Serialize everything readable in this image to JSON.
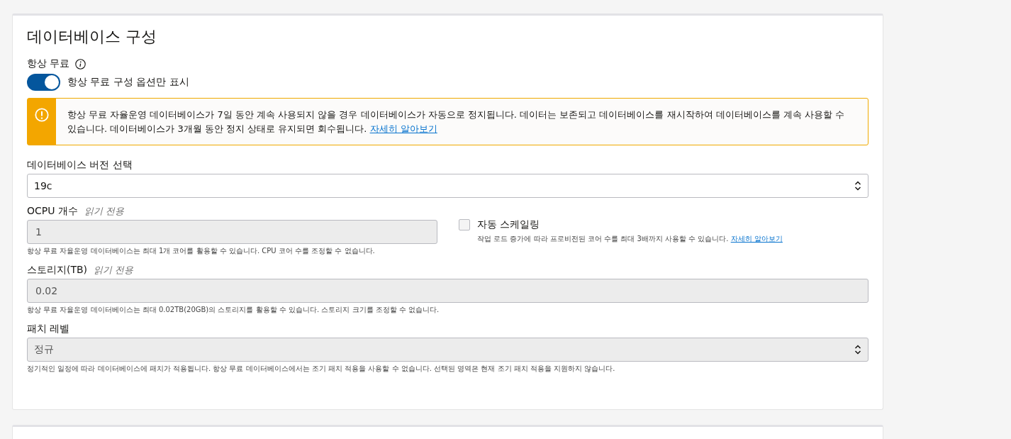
{
  "section": {
    "title": "데이터베이스 구성"
  },
  "always_free": {
    "label": "항상 무료",
    "toggle": {
      "label": "항상 무료 구성 옵션만 표시",
      "on": true
    }
  },
  "alert": {
    "text": "항상 무료 자율운영 데이터베이스가 7일 동안 계속 사용되지 않을 경우 데이터베이스가 자동으로 정지됩니다. 데이터는 보존되고 데이터베이스를 재시작하여 데이터베이스를 계속 사용할 수 있습니다. 데이터베이스가 3개월 동안 정지 상태로 유지되면 회수됩니다.",
    "link": "자세히 알아보기"
  },
  "version": {
    "kind": "select",
    "label": "데이터베이스 버전 선택",
    "value": "19c",
    "disabled": false
  },
  "ocpu": {
    "kind": "input",
    "label": "OCPU 개수",
    "note": "읽기 전용",
    "value": "1",
    "disabled": true,
    "help": "항상 무료 자율운영 데이터베이스는 최대 1개 코어를 활용할 수 있습니다. CPU 코어 수를 조정할 수 없습니다."
  },
  "auto_scaling": {
    "label": "자동 스케일링",
    "checked": false,
    "help": "작업 로드 증가에 따라 프로비전된 코어 수를 최대 3배까지 사용할 수 있습니다.",
    "link": "자세히 알아보기"
  },
  "storage": {
    "kind": "input",
    "label": "스토리지(TB)",
    "note": "읽기 전용",
    "value": "0.02",
    "disabled": true,
    "help": "항상 무료 자율운영 데이터베이스는 최대 0.02TB(20GB)의 스토리지를 활용할 수 있습니다. 스토리지 크기를 조정할 수 없습니다."
  },
  "patch": {
    "kind": "select",
    "label": "패치 레벨",
    "value": "정규",
    "disabled": true,
    "help": "정기적인 일정에 따라 데이터베이스에 패치가 적용됩니다. 항상 무료 데이터베이스에서는 조기 패치 적용을 사용할 수 없습니다. 선택된 영역은 현재 조기 패치 적용을 지원하지 않습니다."
  }
}
